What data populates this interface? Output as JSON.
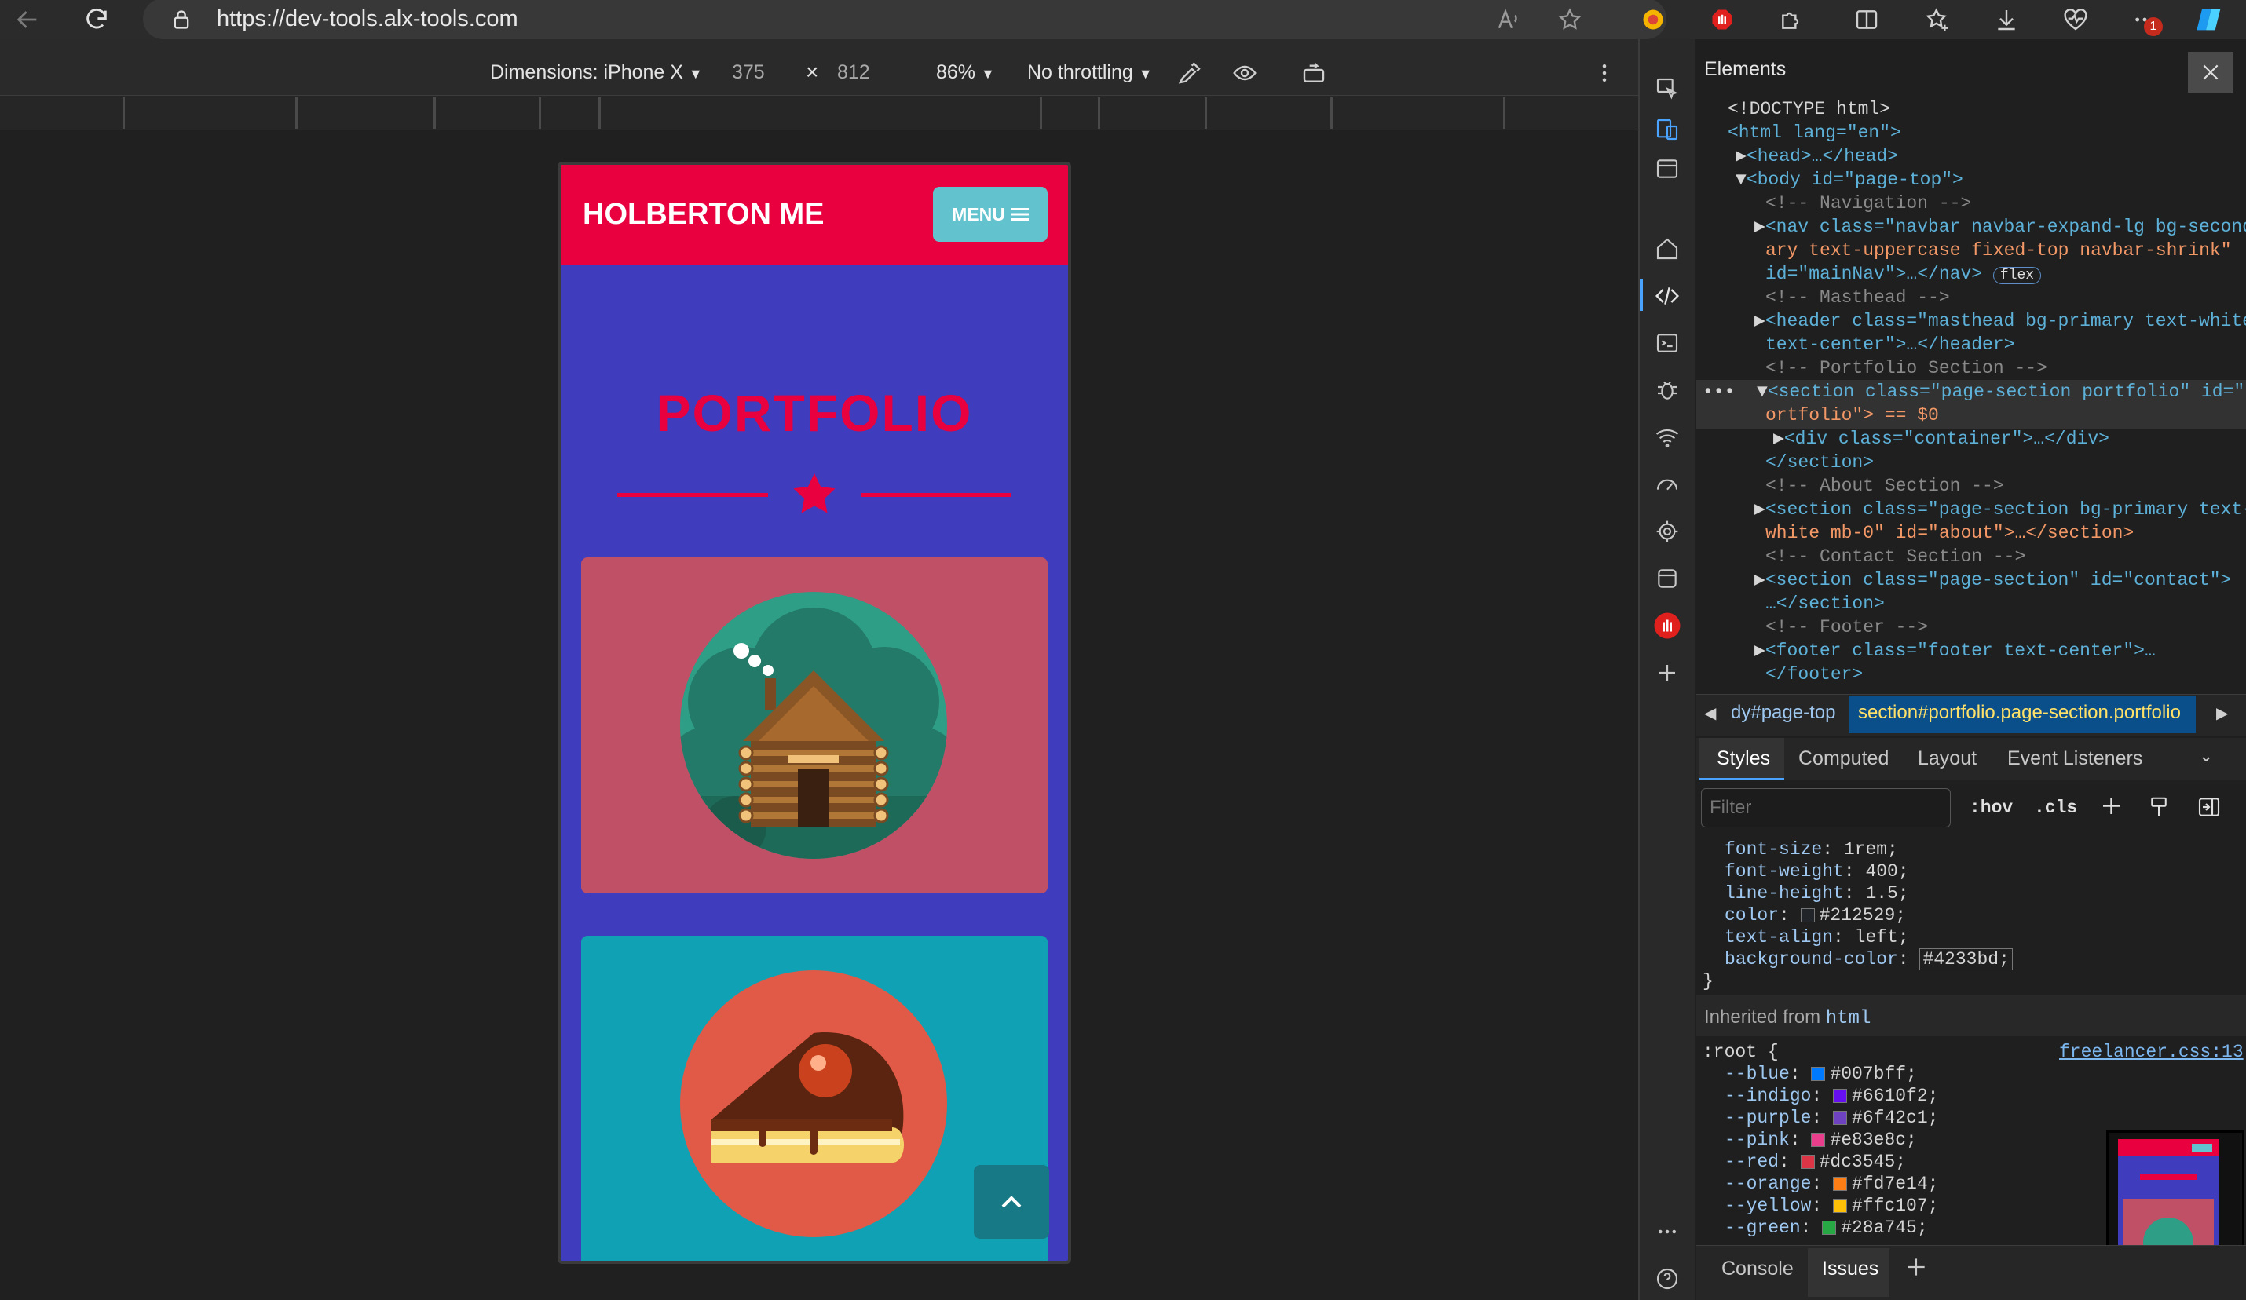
{
  "browser": {
    "url": "https://dev-tools.alx-tools.com",
    "badge": "1"
  },
  "device_toolbar": {
    "dimensions": "Dimensions: iPhone X",
    "width": "375",
    "times": "×",
    "height": "812",
    "zoom": "86%",
    "throttling": "No throttling"
  },
  "site": {
    "brand": "HOLBERTON ME",
    "menu": "MENU",
    "title": "PORTFOLIO"
  },
  "devtools": {
    "panel_title": "Elements",
    "dom": [
      "<!DOCTYPE html>",
      "<html lang=\"en\">",
      "<head>…</head>",
      "<body id=\"page-top\">",
      "<!-- Navigation -->",
      "<nav class=\"navbar navbar-expand-lg bg-second",
      "ary text-uppercase fixed-top navbar-shrink\"",
      "id=\"mainNav\">…</nav>",
      "<!-- Masthead -->",
      "<header class=\"masthead bg-primary text-white",
      "text-center\">…</header>",
      "<!-- Portfolio Section -->",
      "<section class=\"page-section portfolio\" id=\"p",
      "ortfolio\"> == $0",
      "<div class=\"container\">…</div>",
      "</section>",
      "<!-- About Section -->",
      "<section class=\"page-section bg-primary text-",
      "white mb-0\" id=\"about\">…</section>",
      "<!-- Contact Section -->",
      "<section class=\"page-section\" id=\"contact\">",
      "…</section>",
      "<!-- Footer -->",
      "<footer class=\"footer text-center\">…",
      "</footer>"
    ],
    "flex_badge": "flex",
    "crumb_prev": "dy#page-top",
    "crumb_current": "section#portfolio.page-section.portfolio",
    "tabs": [
      "Styles",
      "Computed",
      "Layout",
      "Event Listeners"
    ],
    "filter_placeholder": "Filter",
    "hov": ":hov",
    "cls": ".cls",
    "styles": [
      {
        "p": "font-size",
        "v": "1rem;"
      },
      {
        "p": "font-weight",
        "v": "400;"
      },
      {
        "p": "line-height",
        "v": "1.5;"
      },
      {
        "p": "color",
        "v": "#212529;",
        "c": "#212529"
      },
      {
        "p": "text-align",
        "v": "left;"
      },
      {
        "p": "background-color",
        "v": "#4233bd;"
      }
    ],
    "close_brace": "}",
    "inherited_label": "Inherited from",
    "inherited_tag": "html",
    "root_selector": ":root {",
    "root_source": "freelancer.css:13",
    "root_vars": [
      {
        "p": "--blue",
        "v": "#007bff;",
        "c": "#007bff"
      },
      {
        "p": "--indigo",
        "v": "#6610f2;",
        "c": "#6610f2"
      },
      {
        "p": "--purple",
        "v": "#6f42c1;",
        "c": "#6f42c1"
      },
      {
        "p": "--pink",
        "v": "#e83e8c;",
        "c": "#e83e8c"
      },
      {
        "p": "--red",
        "v": "#dc3545;",
        "c": "#dc3545"
      },
      {
        "p": "--orange",
        "v": "#fd7e14;",
        "c": "#fd7e14"
      },
      {
        "p": "--yellow",
        "v": "#ffc107;",
        "c": "#ffc107"
      },
      {
        "p": "--green",
        "v": "#28a745;",
        "c": "#28a745"
      }
    ],
    "bottom_tabs": [
      "Console",
      "Issues"
    ]
  },
  "colors": {
    "brand_red": "#e8003f",
    "page_bg": "#3f3cbd",
    "menu_btn": "#62c3cf",
    "card1": "#bf5066",
    "card2": "#10a2b4"
  }
}
